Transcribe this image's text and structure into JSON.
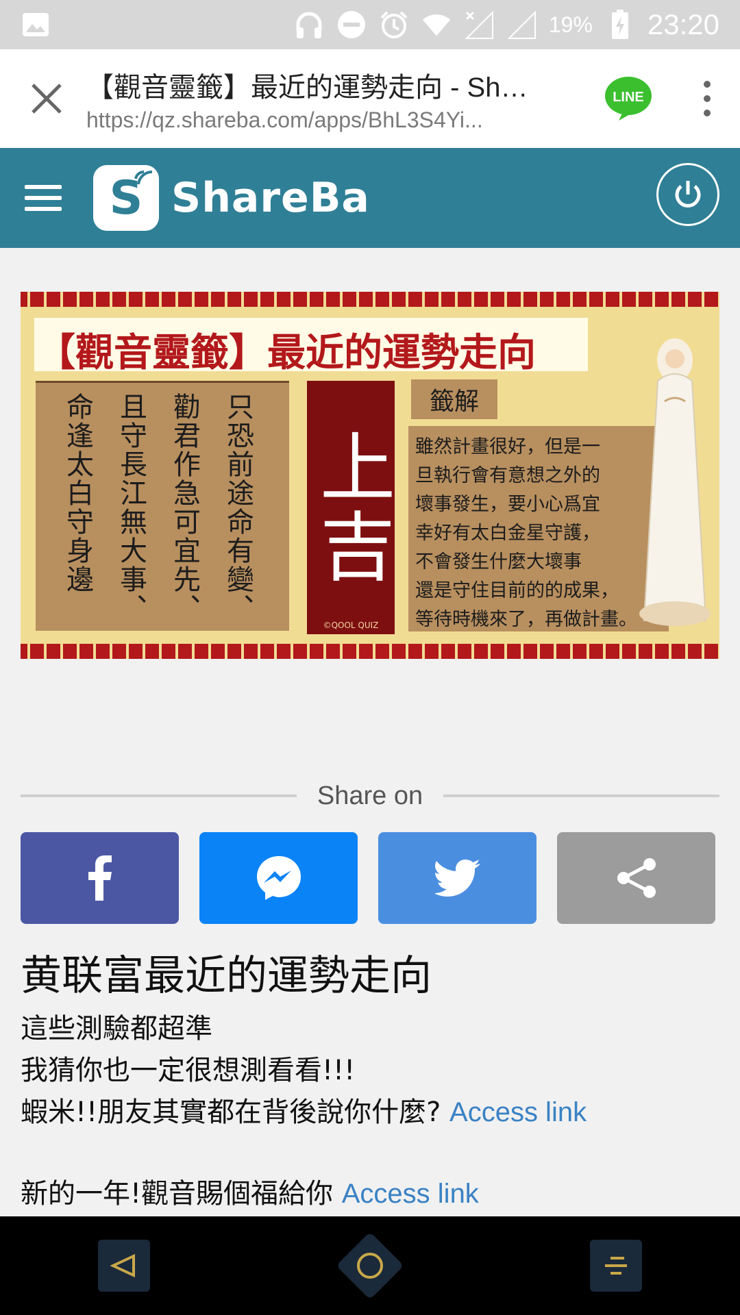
{
  "status_bar": {
    "battery_percent": "19%",
    "time": "23:20",
    "icons": [
      "image-icon",
      "headphones-icon",
      "do-not-disturb-icon",
      "alarm-icon",
      "wifi-icon",
      "signal-no-service-icon",
      "signal-empty-icon",
      "battery-charging-icon"
    ]
  },
  "custom_tab": {
    "title": "【觀音靈籤】最近的運勢走向 - Shar...",
    "url": "https://qz.shareba.com/apps/BhL3S4Yi...",
    "line_label": "LINE"
  },
  "header": {
    "logo_letter": "S",
    "logo_text": "ShareBa"
  },
  "fortune": {
    "title": "【觀音靈籤】最近的運勢走向",
    "poem_columns": [
      "只恐前途命有變、",
      "勸君作急可宜先、",
      "且守長江無大事、",
      "命逢太白守身邊"
    ],
    "omen": "上吉",
    "omen_credit": "©QOOL QUIZ",
    "jieshi_label": "籤解",
    "description": [
      "雖然計畫很好，但是一",
      "旦執行會有意想之外的",
      "壞事發生，要小心爲宜",
      "幸好有太白金星守護，",
      "不會發生什麼大壞事",
      "還是守住目前的的成果，",
      "等待時機來了，再做計畫。"
    ]
  },
  "share": {
    "label": "Share on",
    "buttons": [
      {
        "name": "facebook",
        "icon": "facebook-icon",
        "color": "#4c57a4"
      },
      {
        "name": "messenger",
        "icon": "messenger-icon",
        "color": "#0a83f6"
      },
      {
        "name": "twitter",
        "icon": "twitter-icon",
        "color": "#4a8ee0"
      },
      {
        "name": "share",
        "icon": "share-icon",
        "color": "#9c9c9c"
      }
    ]
  },
  "article": {
    "heading": "黄联富最近的運勢走向",
    "line1": "這些測驗都超準",
    "line2": "我猜你也一定很想測看看!!!",
    "line3_text": "蝦米!!朋友其實都在背後說你什麼? ",
    "line3_link": "Access link",
    "line4_text": "新的一年!觀音賜個福給你 ",
    "line4_link": "Access link"
  },
  "colors": {
    "header_bg": "#2f7f96",
    "link": "#3a82c4",
    "fortune_red": "#b3181b"
  }
}
